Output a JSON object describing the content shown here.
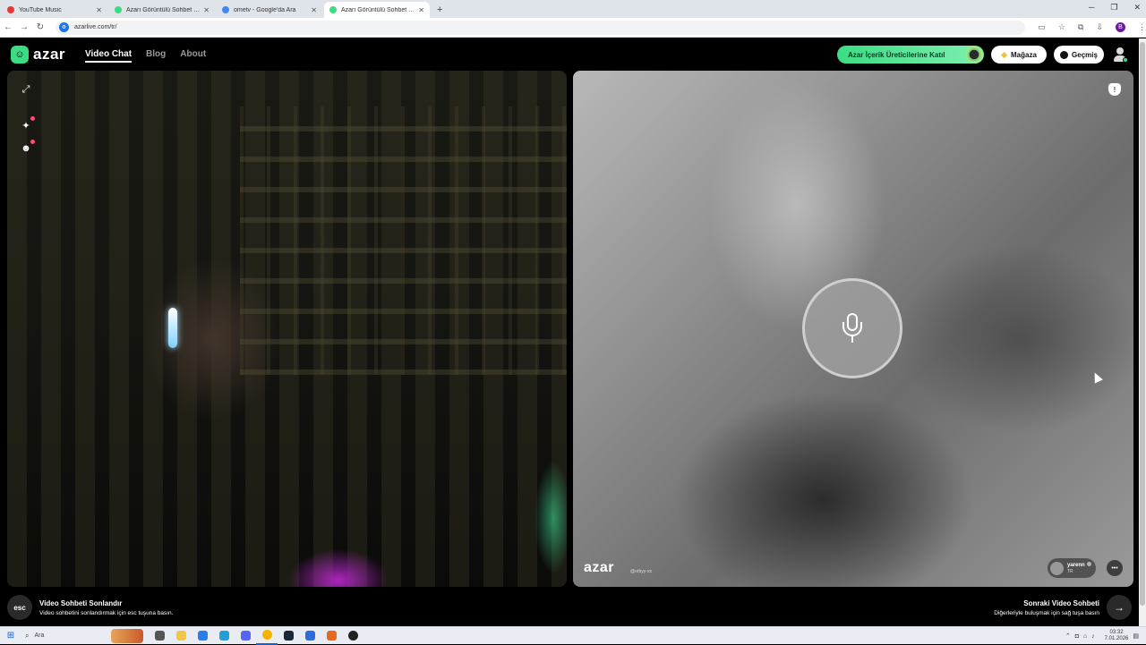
{
  "browser": {
    "tabs": [
      {
        "label": "YouTube Music",
        "color": "#e53935",
        "active": false
      },
      {
        "label": "Azarı Görüntülü Sohbet & Yeni",
        "color": "#3ddc84",
        "active": false
      },
      {
        "label": "ometv - Google'da Ara",
        "color": "#4285f4",
        "active": false
      },
      {
        "label": "Azarı Görüntülü Sohbet & Y",
        "color": "#3ddc84",
        "active": true
      }
    ],
    "new_tab": "+",
    "url": "azarlive.com/tr/",
    "profile_initial": "B"
  },
  "site": {
    "logo_text": "azar",
    "nav": [
      {
        "label": "Video Chat",
        "active": true
      },
      {
        "label": "Blog",
        "active": false
      },
      {
        "label": "About",
        "active": false
      }
    ],
    "creator_button": "Azar İçerik Üreticilerine Katıl",
    "store_button": "Mağaza",
    "history_button": "Geçmiş",
    "accent_color": "#3ddc84"
  },
  "video": {
    "watermark": "azar",
    "watermark_sub": "@orbyy-xs",
    "partner": {
      "name": "yarenn",
      "country": "TR"
    }
  },
  "bottom": {
    "end_key": "esc",
    "end_title": "Video Sohbeti Sonlandır",
    "end_desc": "Video sohbetini sonlandırmak için esc tuşuna basın.",
    "next_title": "Sonraki Video Sohbeti",
    "next_desc": "Diğerleriyle buluşmak için sağ tuşa basın"
  },
  "taskbar": {
    "search_placeholder": "Ara",
    "time": "03:32",
    "date": "7.01.2026"
  }
}
